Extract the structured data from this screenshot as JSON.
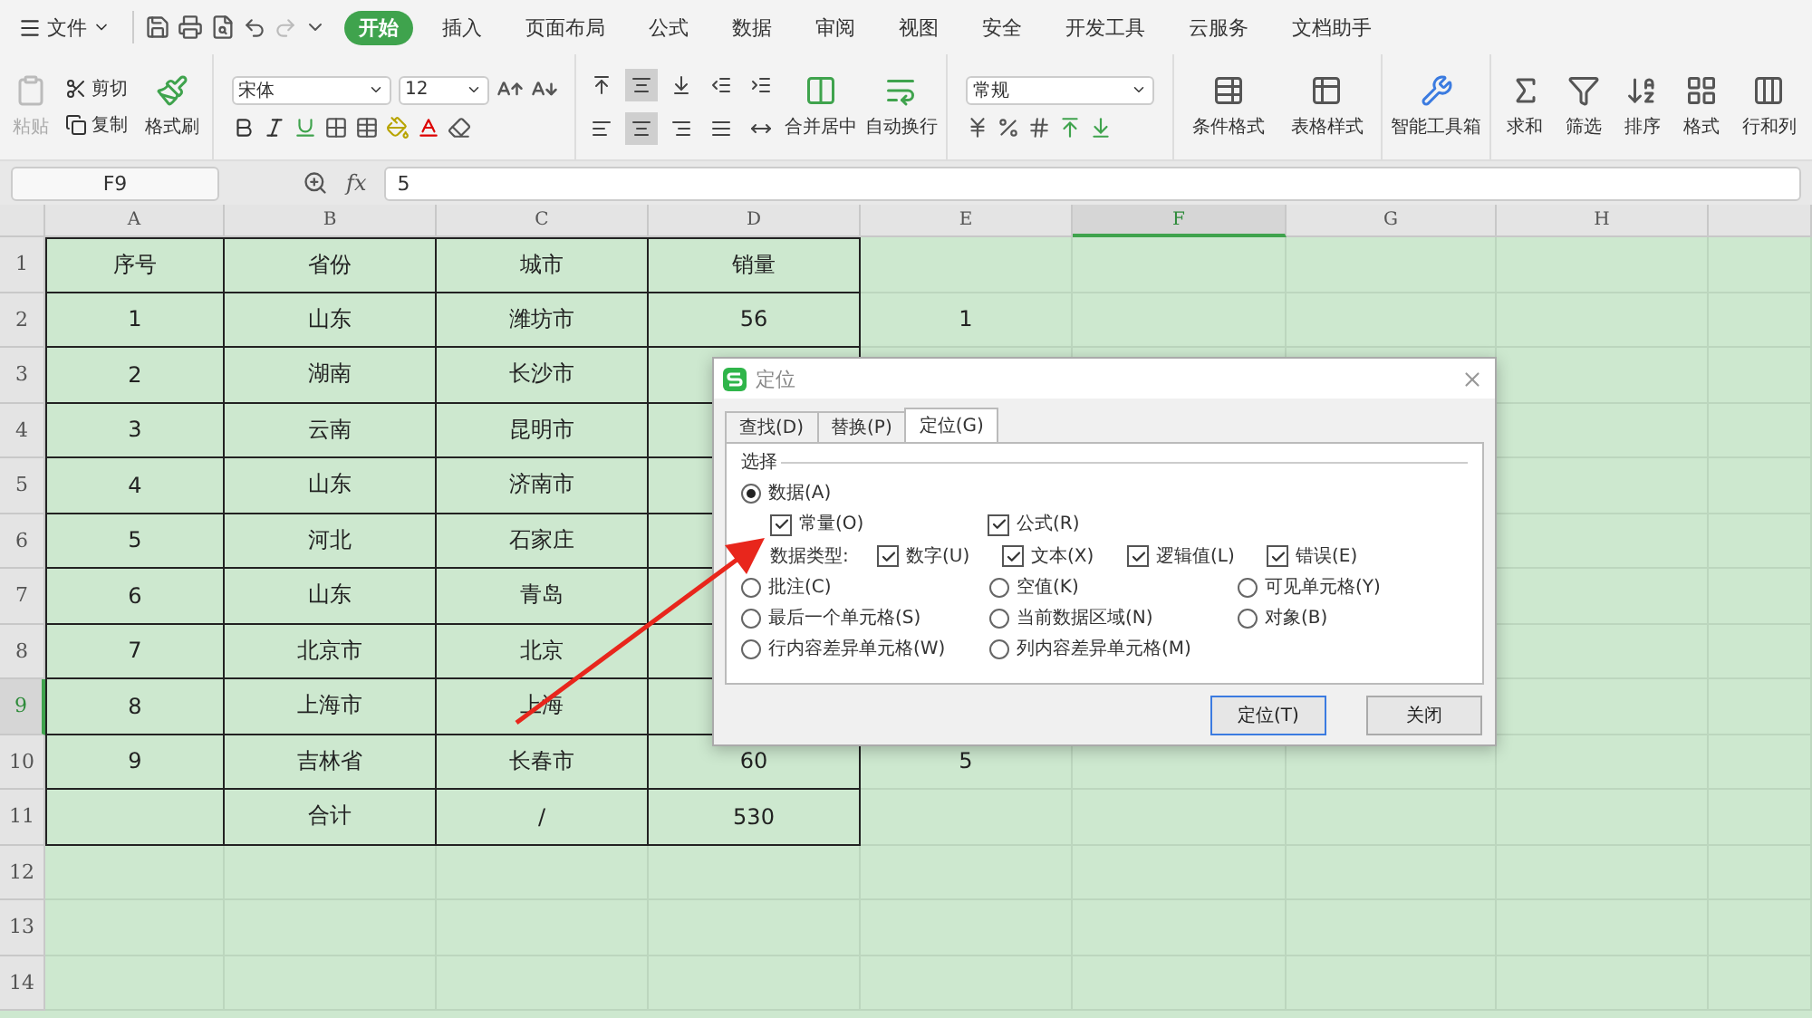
{
  "menu": {
    "file": "文件",
    "tabs": [
      {
        "label": "开始",
        "selected": true
      },
      {
        "label": "插入",
        "selected": false
      },
      {
        "label": "页面布局",
        "selected": false
      },
      {
        "label": "公式",
        "selected": false
      },
      {
        "label": "数据",
        "selected": false
      },
      {
        "label": "审阅",
        "selected": false
      },
      {
        "label": "视图",
        "selected": false
      },
      {
        "label": "安全",
        "selected": false
      },
      {
        "label": "开发工具",
        "selected": false
      },
      {
        "label": "云服务",
        "selected": false
      },
      {
        "label": "文档助手",
        "selected": false
      }
    ]
  },
  "ribbon": {
    "paste": {
      "label": "粘贴",
      "disabled": true
    },
    "cut": "剪切",
    "copy": "复制",
    "format_painter": "格式刷",
    "font_name": "宋体",
    "font_size": "12",
    "align_top": [
      {
        "pressed": false
      },
      {
        "pressed": true
      },
      {
        "pressed": false
      },
      {
        "pressed": false
      },
      {
        "pressed": false
      }
    ],
    "align_bottom": [
      {
        "pressed": false
      },
      {
        "pressed": true
      },
      {
        "pressed": false
      },
      {
        "pressed": false
      },
      {
        "pressed": false
      }
    ],
    "merge": "合并居中",
    "wrap": "自动换行",
    "number_format": "常规",
    "styles": [
      "条件格式",
      "表格样式"
    ],
    "toolbox": "智能工具箱",
    "editing": [
      "求和",
      "筛选",
      "排序",
      "格式",
      "行和列"
    ]
  },
  "formula_bar": {
    "cell_ref": "F9",
    "fx_label": "fx",
    "value": "5"
  },
  "sheet": {
    "columns": [
      {
        "label": "A",
        "selected": false
      },
      {
        "label": "B",
        "selected": false
      },
      {
        "label": "C",
        "selected": false
      },
      {
        "label": "D",
        "selected": false
      },
      {
        "label": "E",
        "selected": false
      },
      {
        "label": "F",
        "selected": true
      },
      {
        "label": "G",
        "selected": false
      },
      {
        "label": "H",
        "selected": false
      }
    ],
    "rows": [
      {
        "label": "1",
        "selected": false,
        "cells": [
          "序号",
          "省份",
          "城市",
          "销量",
          null
        ]
      },
      {
        "label": "2",
        "selected": false,
        "cells": [
          "1",
          "山东",
          "潍坊市",
          "56",
          "1"
        ]
      },
      {
        "label": "3",
        "selected": false,
        "cells": [
          "2",
          "湖南",
          "长沙市",
          null,
          null
        ]
      },
      {
        "label": "4",
        "selected": false,
        "cells": [
          "3",
          "云南",
          "昆明市",
          null,
          null
        ]
      },
      {
        "label": "5",
        "selected": false,
        "cells": [
          "4",
          "山东",
          "济南市",
          null,
          null
        ]
      },
      {
        "label": "6",
        "selected": false,
        "cells": [
          "5",
          "河北",
          "石家庄",
          null,
          null
        ]
      },
      {
        "label": "7",
        "selected": false,
        "cells": [
          "6",
          "山东",
          "青岛",
          null,
          null
        ]
      },
      {
        "label": "8",
        "selected": false,
        "cells": [
          "7",
          "北京市",
          "北京",
          null,
          null
        ]
      },
      {
        "label": "9",
        "selected": true,
        "cells": [
          "8",
          "上海市",
          "上海",
          null,
          null
        ]
      },
      {
        "label": "10",
        "selected": false,
        "cells": [
          "9",
          "吉林省",
          "长春市",
          "60",
          "5"
        ]
      },
      {
        "label": "11",
        "selected": false,
        "cells": [
          null,
          "合计",
          "/",
          "530",
          null
        ]
      },
      {
        "label": "12",
        "selected": false,
        "cells": []
      },
      {
        "label": "13",
        "selected": false,
        "cells": []
      },
      {
        "label": "14",
        "selected": false,
        "cells": []
      }
    ]
  },
  "dialog": {
    "title": "定位",
    "tabs": [
      {
        "label": "查找(D)",
        "selected": false
      },
      {
        "label": "替换(P)",
        "selected": false
      },
      {
        "label": "定位(G)",
        "selected": true
      }
    ],
    "section": "选择",
    "data_option": {
      "label": "数据(A)",
      "selected": true
    },
    "data_subtypes": [
      {
        "label": "常量(O)",
        "checked": true
      },
      {
        "label": "公式(R)",
        "checked": true
      }
    ],
    "data_type_label": "数据类型:",
    "data_types": [
      {
        "label": "数字(U)",
        "checked": true
      },
      {
        "label": "文本(X)",
        "checked": true
      },
      {
        "label": "逻辑值(L)",
        "checked": true
      },
      {
        "label": "错误(E)",
        "checked": true
      }
    ],
    "other_options": [
      {
        "label": "批注(C)",
        "selected": false
      },
      {
        "label": "空值(K)",
        "selected": false
      },
      {
        "label": "可见单元格(Y)",
        "selected": false
      },
      {
        "label": "最后一个单元格(S)",
        "selected": false
      },
      {
        "label": "当前数据区域(N)",
        "selected": false
      },
      {
        "label": "对象(B)",
        "selected": false
      },
      {
        "label": "行内容差异单元格(W)",
        "selected": false
      },
      {
        "label": "列内容差异单元格(M)",
        "selected": false
      }
    ],
    "buttons": [
      {
        "label": "定位(T)",
        "default": true
      },
      {
        "label": "关闭",
        "default": false
      }
    ]
  }
}
